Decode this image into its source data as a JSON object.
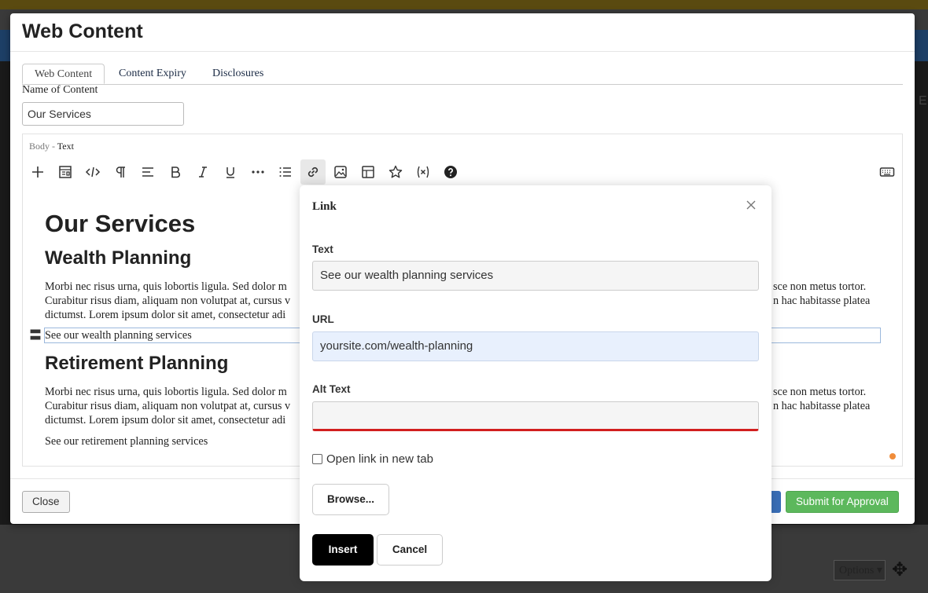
{
  "modal": {
    "title": "Web Content",
    "tabs": [
      {
        "label": "Web Content",
        "active": true
      },
      {
        "label": "Content Expiry",
        "active": false
      },
      {
        "label": "Disclosures",
        "active": false
      }
    ],
    "name_label": "Name of Content",
    "name_value": "Our Services",
    "body_label": "Body -",
    "body_mode": "Text",
    "toolbar_icons": [
      "plus-icon",
      "template-icon",
      "code-icon",
      "paragraph-icon",
      "align-icon",
      "bold-icon",
      "italic-icon",
      "underline-icon",
      "more-icon",
      "list-icon",
      "link-icon",
      "image-icon",
      "table-icon",
      "star-icon",
      "variable-icon",
      "help-icon",
      "keyboard-icon"
    ],
    "content": {
      "h1": "Our Services",
      "sections": [
        {
          "heading": "Wealth Planning",
          "lines": [
            "Morbi nec risus urna, quis lobortis ligula. Sed dolor m",
            "Curabitur risus diam, aliquam non volutpat at, cursus v",
            "dictumst. Lorem ipsum dolor sit amet, consectetur adi"
          ],
          "lines_right": [
            "sce non metus tortor.",
            "n hac habitasse platea"
          ],
          "link": "See our wealth planning services"
        },
        {
          "heading": "Retirement Planning",
          "lines": [
            "Morbi nec risus urna, quis lobortis ligula. Sed dolor m",
            "Curabitur risus diam, aliquam non volutpat at, cursus v",
            "dictumst. Lorem ipsum dolor sit amet, consectetur adi"
          ],
          "lines_right": [
            "sce non metus tortor.",
            "n hac habitasse platea"
          ],
          "link": "See our retirement planning services"
        }
      ]
    },
    "footer": {
      "close_label": "Close",
      "submit_label": "Submit for Approval"
    }
  },
  "dialog": {
    "title": "Link",
    "text_label": "Text",
    "text_value": "See our wealth planning services",
    "url_label": "URL",
    "url_value": "yoursite.com/wealth-planning",
    "alt_label": "Alt Text",
    "alt_value": "",
    "new_tab_label": "Open link in new tab",
    "new_tab_checked": false,
    "browse_label": "Browse...",
    "insert_label": "Insert",
    "cancel_label": "Cancel"
  },
  "background": {
    "options_label": "Options",
    "edge_letter": "E"
  },
  "colors": {
    "submit_green": "#5cb85c",
    "error_red": "#d21f1f",
    "url_highlight": "#e8f0fd",
    "header_blue": "#1d3f66"
  }
}
